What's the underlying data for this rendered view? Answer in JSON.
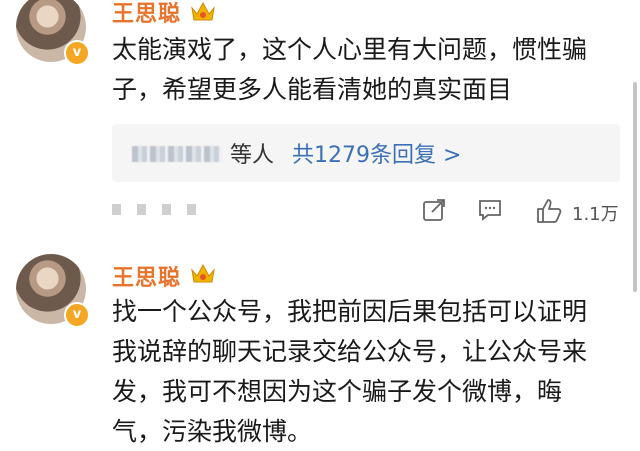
{
  "comments": [
    {
      "user": "王思聪",
      "verified": "v",
      "lines": [
        "太能演戏了，这个人心里有大问题，惯性骗",
        "子，希望更多人能看清她的真实面目"
      ],
      "replies": {
        "suffix": "等人",
        "total": "共1279条回复 >"
      },
      "actions": {
        "share_icon": "share-icon",
        "comment_icon": "comment-icon",
        "like_icon": "thumbs-up-icon",
        "like_count": "1.1万"
      }
    },
    {
      "user": "王思聪",
      "verified": "v",
      "lines": [
        "找一个公众号，我把前因后果包括可以证明",
        "我说辞的聊天记录交给公众号，让公众号来",
        "发，我可不想因为这个骗子发个微博，晦",
        "气，污染我微博。"
      ]
    }
  ],
  "colors": {
    "username": "#e8742b",
    "link": "#3b6fb6",
    "badge": "#f5a623"
  }
}
